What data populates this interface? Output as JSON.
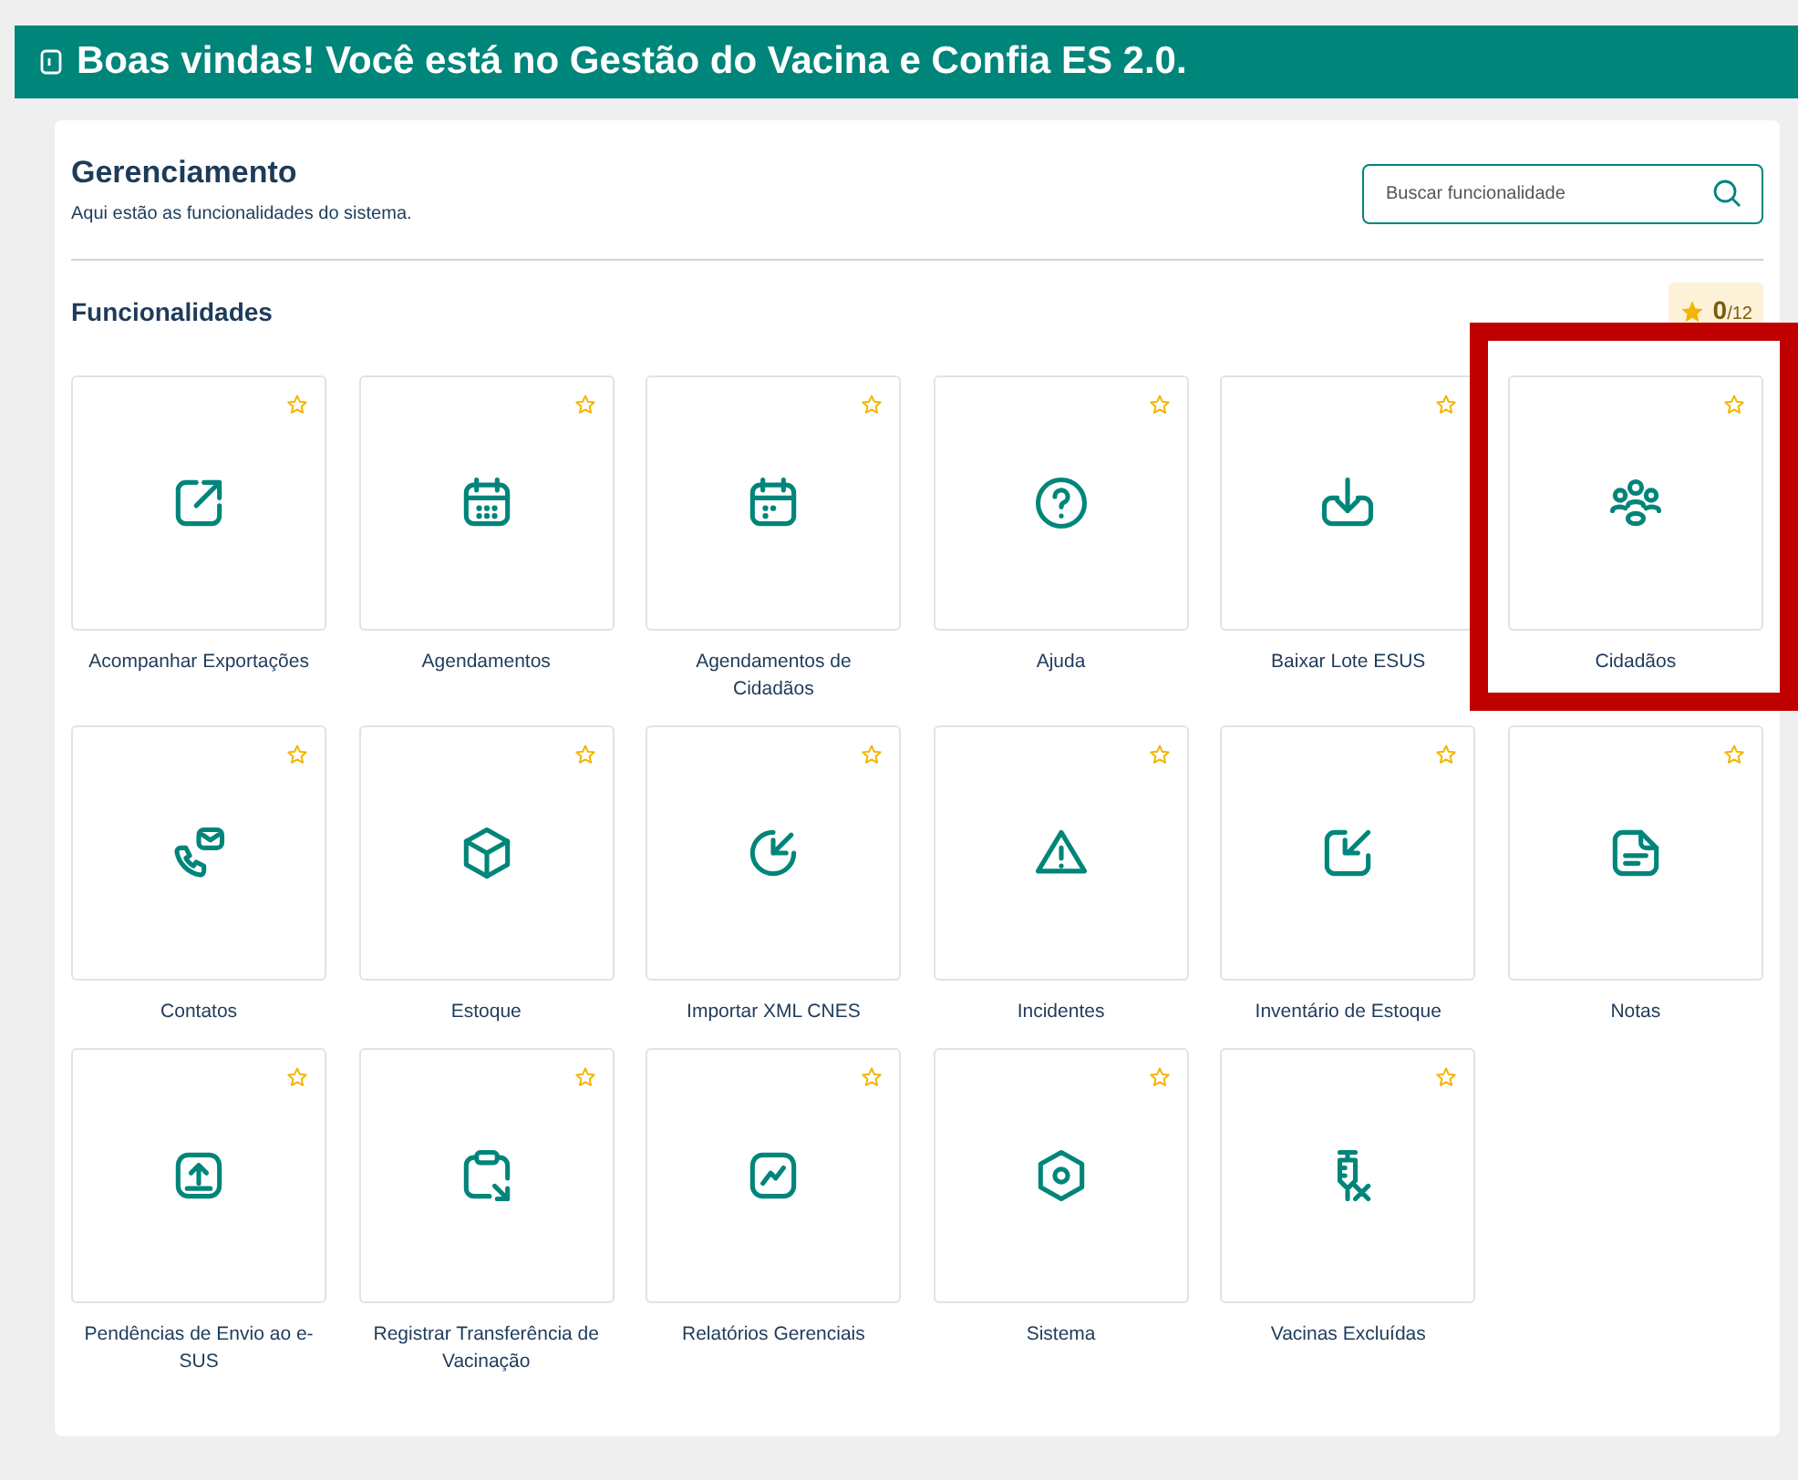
{
  "banner": {
    "title": "Boas vindas! Você está no Gestão do Vacina e Confia ES 2.0."
  },
  "panel": {
    "title": "Gerenciamento",
    "subtitle": "Aqui estão as funcionalidades do sistema.",
    "search": {
      "placeholder": "Buscar funcionalidade"
    }
  },
  "section": {
    "title": "Funcionalidades",
    "favorites_count": "0",
    "favorites_total": "/12"
  },
  "features": [
    {
      "label": "Acompanhar Exportações",
      "favorite": false,
      "highlighted": false
    },
    {
      "label": "Agendamentos",
      "favorite": false,
      "highlighted": false
    },
    {
      "label": "Agendamentos de Cidadãos",
      "favorite": false,
      "highlighted": false
    },
    {
      "label": "Ajuda",
      "favorite": false,
      "highlighted": false
    },
    {
      "label": "Baixar Lote ESUS",
      "favorite": false,
      "highlighted": false
    },
    {
      "label": "Cidadãos",
      "favorite": false,
      "highlighted": true
    },
    {
      "label": "Contatos",
      "favorite": false,
      "highlighted": false
    },
    {
      "label": "Estoque",
      "favorite": false,
      "highlighted": false
    },
    {
      "label": "Importar XML CNES",
      "favorite": false,
      "highlighted": false
    },
    {
      "label": "Incidentes",
      "favorite": false,
      "highlighted": false
    },
    {
      "label": "Inventário de Estoque",
      "favorite": false,
      "highlighted": false
    },
    {
      "label": "Notas",
      "favorite": false,
      "highlighted": false
    },
    {
      "label": "Pendências de Envio ao e-SUS",
      "favorite": false,
      "highlighted": false
    },
    {
      "label": "Registrar Transferência de Vacinação",
      "favorite": false,
      "highlighted": false
    },
    {
      "label": "Relatórios Gerenciais",
      "favorite": false,
      "highlighted": false
    },
    {
      "label": "Sistema",
      "favorite": false,
      "highlighted": false
    },
    {
      "label": "Vacinas Excluídas",
      "favorite": false,
      "highlighted": false
    }
  ]
}
